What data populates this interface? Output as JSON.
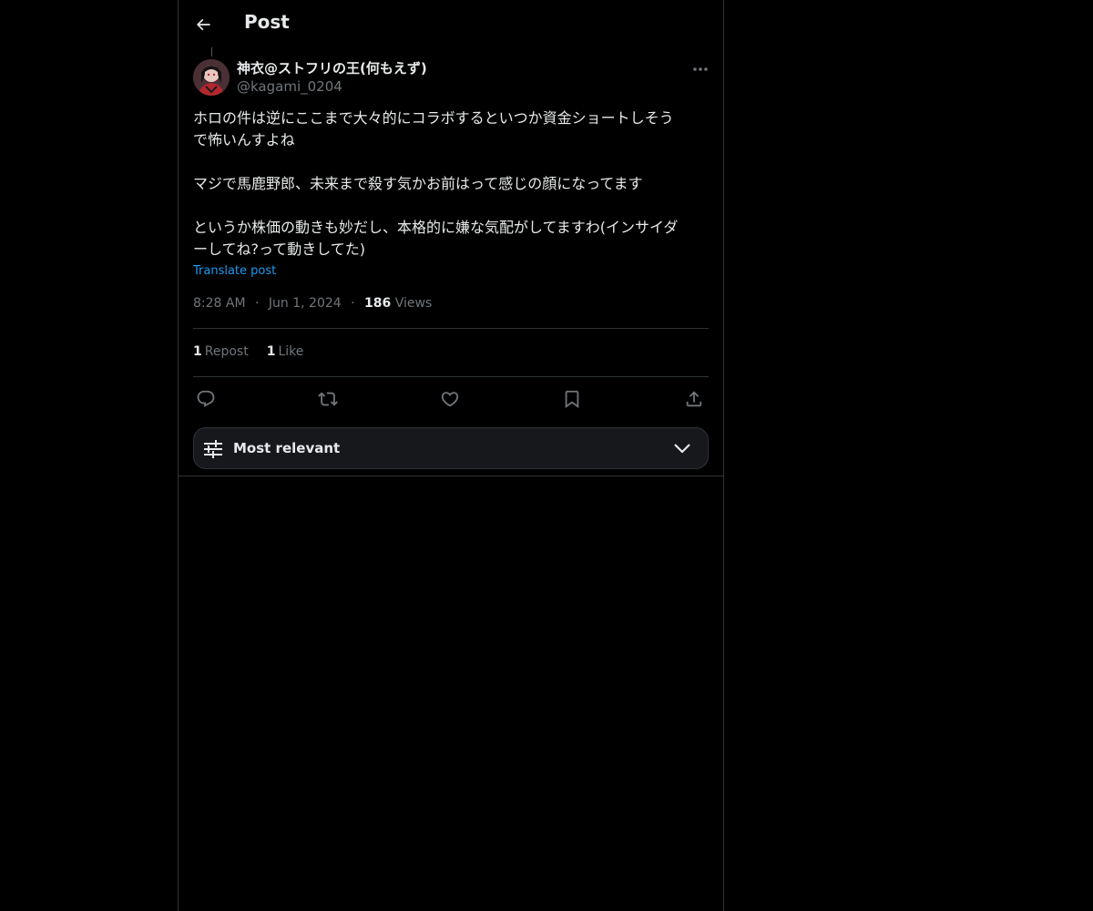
{
  "header": {
    "title": "Post",
    "back_icon": "arrow-left-icon"
  },
  "post": {
    "author": {
      "name": "神衣@ストフリの王(何もえず)",
      "handle": "@kagami_0204"
    },
    "paragraphs": [
      [
        "ホロの件は逆にここまで大々的にコラボするといつか資金ショートしそう",
        "で怖いんすよね"
      ],
      [
        "マジで馬鹿野郎、未来まで殺す気かお前はって感じの顔になってます"
      ],
      [
        "というか株価の動きも妙だし、本格的に嫌な気配がしてますわ(インサイダ",
        "ーしてね?って動きしてた)"
      ]
    ],
    "translate_label": "Translate post",
    "time": "8:28 AM",
    "date": "Jun 1, 2024",
    "separator": "·",
    "views_count": "186",
    "views_label": "Views",
    "reposts_count": "1",
    "reposts_label": "Repost",
    "likes_count": "1",
    "likes_label": "Like"
  },
  "actions": [
    "reply-icon",
    "repost-icon",
    "like-icon",
    "bookmark-icon",
    "share-icon"
  ],
  "sort": {
    "label": "Most relevant",
    "icon": "sliders-icon",
    "chevron": "chevron-down-icon"
  },
  "colors": {
    "background": "#000000",
    "text": "#e7e9ea",
    "muted": "#71767b",
    "link": "#1d9bf0",
    "border": "#2f3336"
  }
}
